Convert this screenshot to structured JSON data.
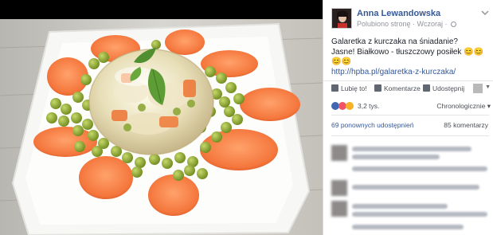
{
  "post": {
    "author": "Anna Lewandowska",
    "meta": "Polubiono stronę · Wczoraj ·",
    "line1": "Galaretka z kurczaka na śniadanie?",
    "line2": "Jasne! Białkowo - tłuszczowy posiłek 😊😊😊😊",
    "link": "http://hpba.pl/galaretka-z-kurczaka/"
  },
  "actions": {
    "like": "Lubię to!",
    "comment": "Komentarze",
    "share": "Udostępnij"
  },
  "stats": {
    "likes": "3,2 tys.",
    "sort": "Chronologicznie ▾",
    "shares": "69 ponownych udostępnień",
    "comments": "85 komentarzy"
  },
  "colors": {
    "accent": "#365899",
    "like": "#4267b2",
    "love": "#f25268",
    "wow": "#f7b125"
  },
  "icons": {
    "chevron": "chevron-down-icon",
    "globe": "globe-icon"
  }
}
